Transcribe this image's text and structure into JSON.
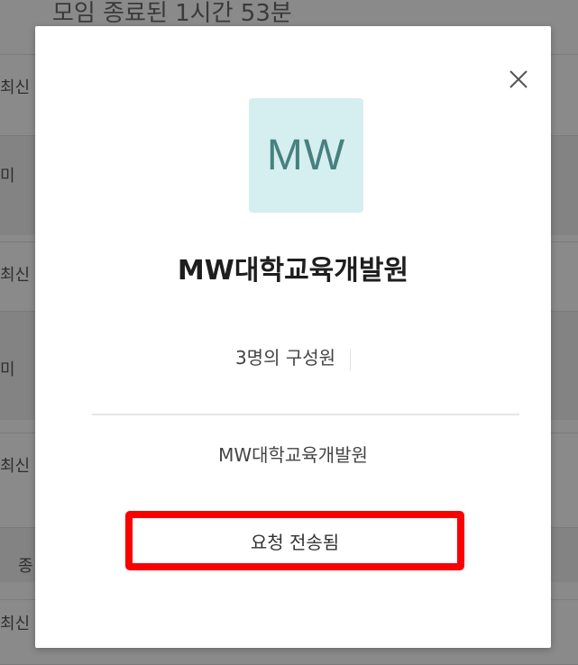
{
  "background": {
    "title": "모임 종료된 1시간 53분",
    "rows": [
      "최신",
      "미",
      "최신",
      "미",
      "최신",
      "종",
      "최신"
    ]
  },
  "modal": {
    "logo_text": "MW",
    "org_name": "MW대학교육개발원",
    "member_count": "3명의 구성원",
    "description": "MW대학교육개발원",
    "request_button": "요청 전송됨",
    "close_icon": "close-icon",
    "logo_bg_color": "#d5eef0",
    "logo_text_color": "#47817f",
    "highlight_color": "#fb0000"
  }
}
